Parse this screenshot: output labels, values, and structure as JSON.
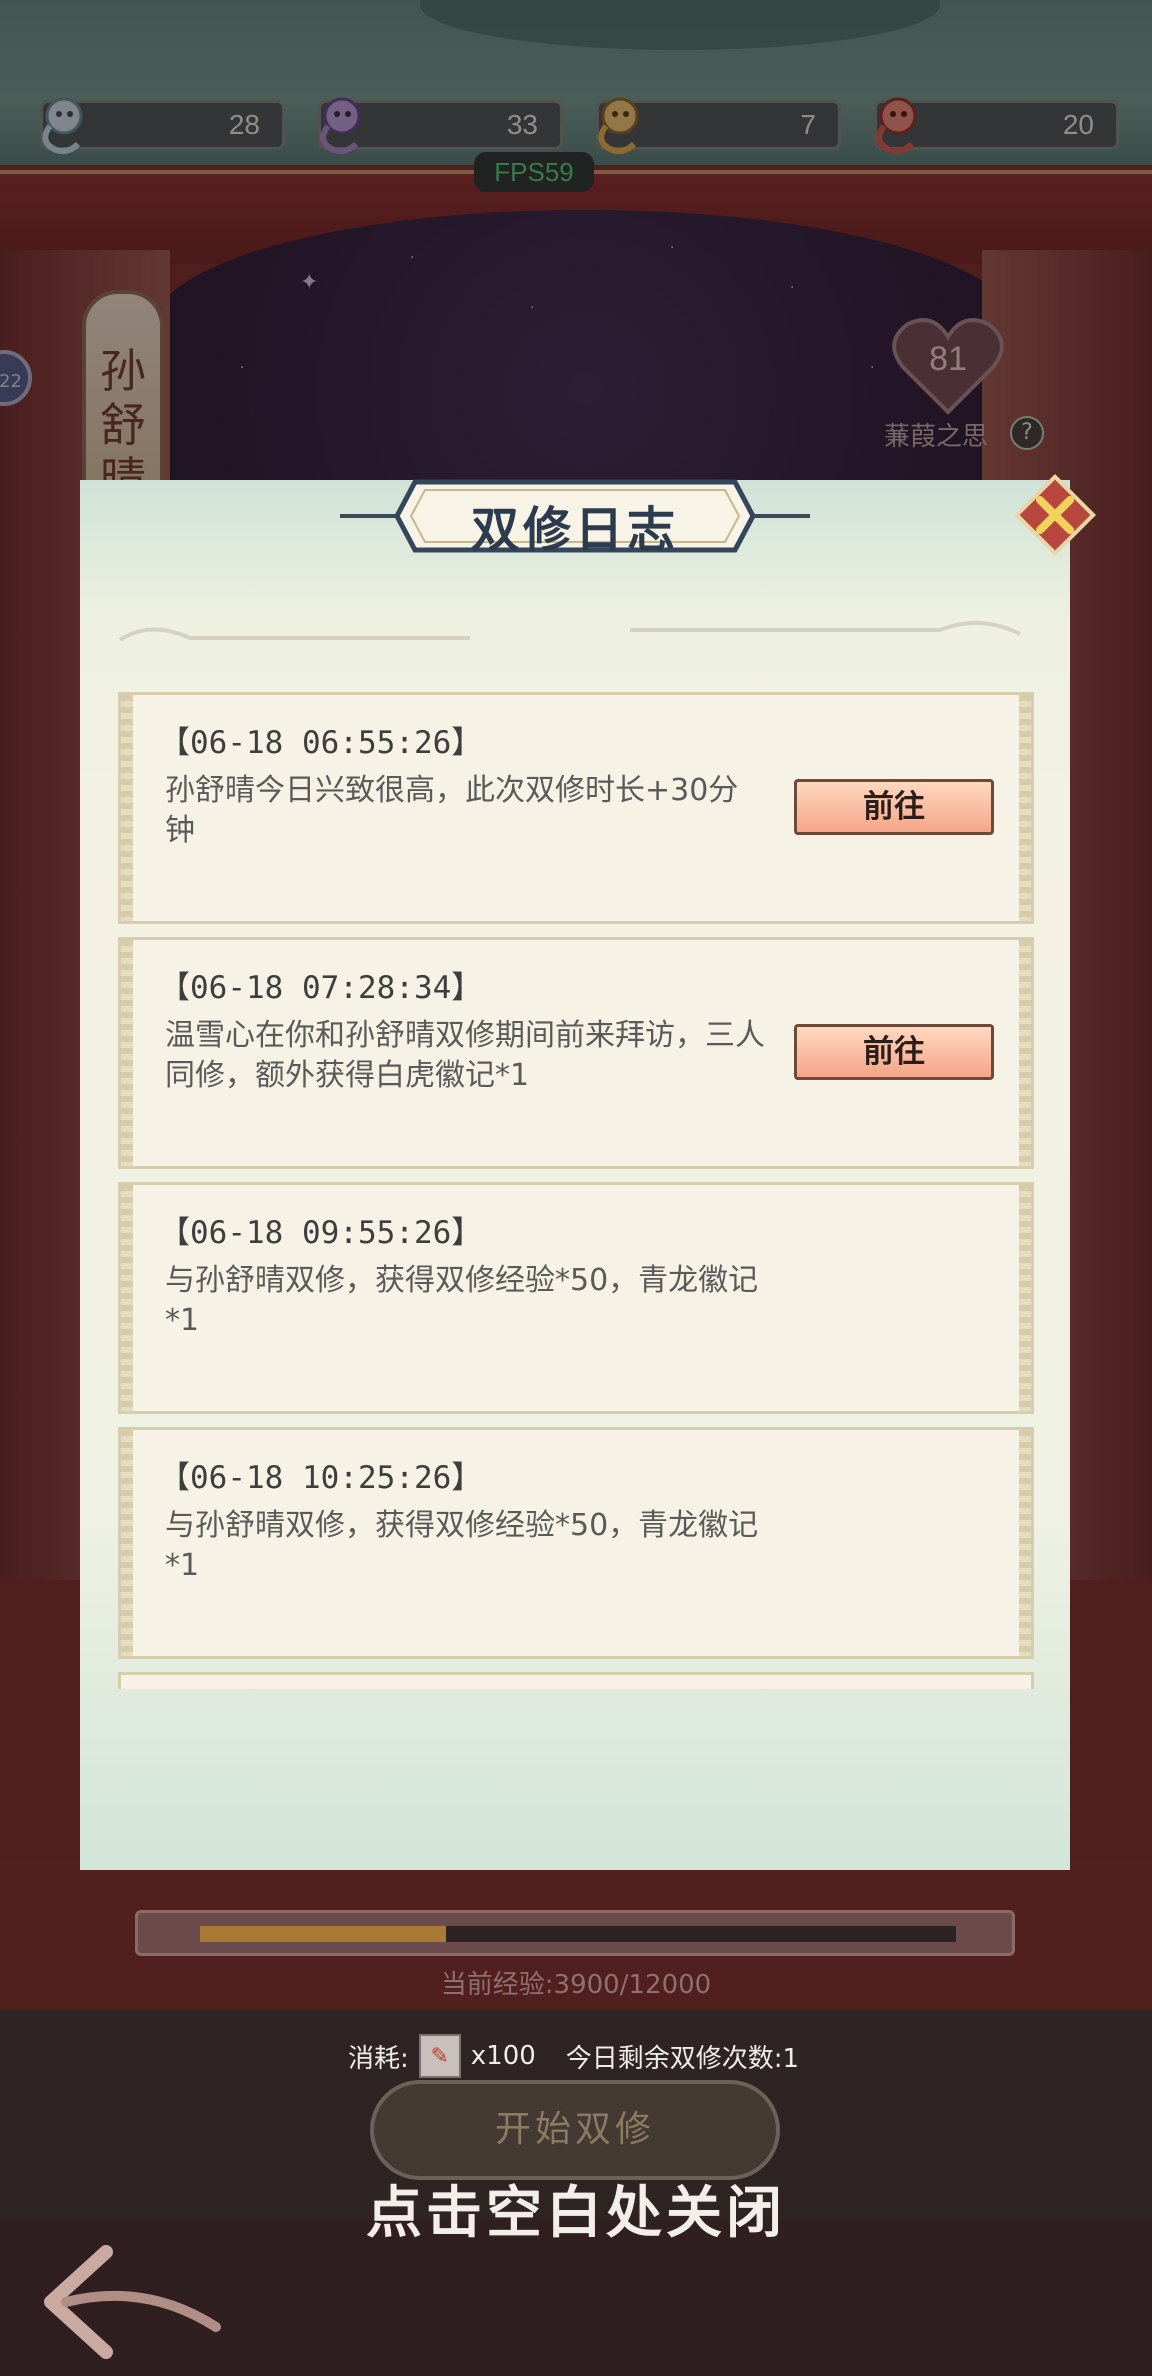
{
  "resources": [
    {
      "name": "blue-spirit-fish",
      "value": "28",
      "color": "#bfe4ee"
    },
    {
      "name": "purple-spirit-fish",
      "value": "33",
      "color": "#a98bd6"
    },
    {
      "name": "gold-spirit-fish",
      "value": "7",
      "color": "#e7b54c"
    },
    {
      "name": "red-spirit-fish",
      "value": "20",
      "color": "#d95b52"
    }
  ],
  "fps_label": "FPS59",
  "character": {
    "name": "孙舒晴",
    "level_badge": "22",
    "affection_value": "81",
    "affection_label": "蒹葭之思",
    "help_symbol": "?"
  },
  "dialog": {
    "title": "双修日志",
    "entries": [
      {
        "time": "【06-18  06:55:26】",
        "text": "孙舒晴今日兴致很高，此次双修时长+30分钟",
        "button": "前往"
      },
      {
        "time": "【06-18  07:28:34】",
        "text": "温雪心在你和孙舒晴双修期间前来拜访，三人同修，额外获得白虎徽记*1",
        "button": "前往"
      },
      {
        "time": "【06-18  09:55:26】",
        "text": "与孙舒晴双修，获得双修经验*50，青龙徽记*1",
        "button": ""
      },
      {
        "time": "【06-18  10:25:26】",
        "text": "与孙舒晴双修，获得双修经验*50，青龙徽记*1",
        "button": ""
      }
    ]
  },
  "experience": {
    "label": "当前经验:3900/12000",
    "progress": 0.325
  },
  "cost": {
    "label": "消耗:",
    "amount": "x100",
    "remaining": "今日剩余双修次数:1"
  },
  "start_button": "开始双修",
  "close_hint": "点击空白处关闭",
  "colors": {
    "accent_button": "#f5a588",
    "dialog_bg": "#f4f1e3",
    "fps_green": "#4fd27a"
  }
}
